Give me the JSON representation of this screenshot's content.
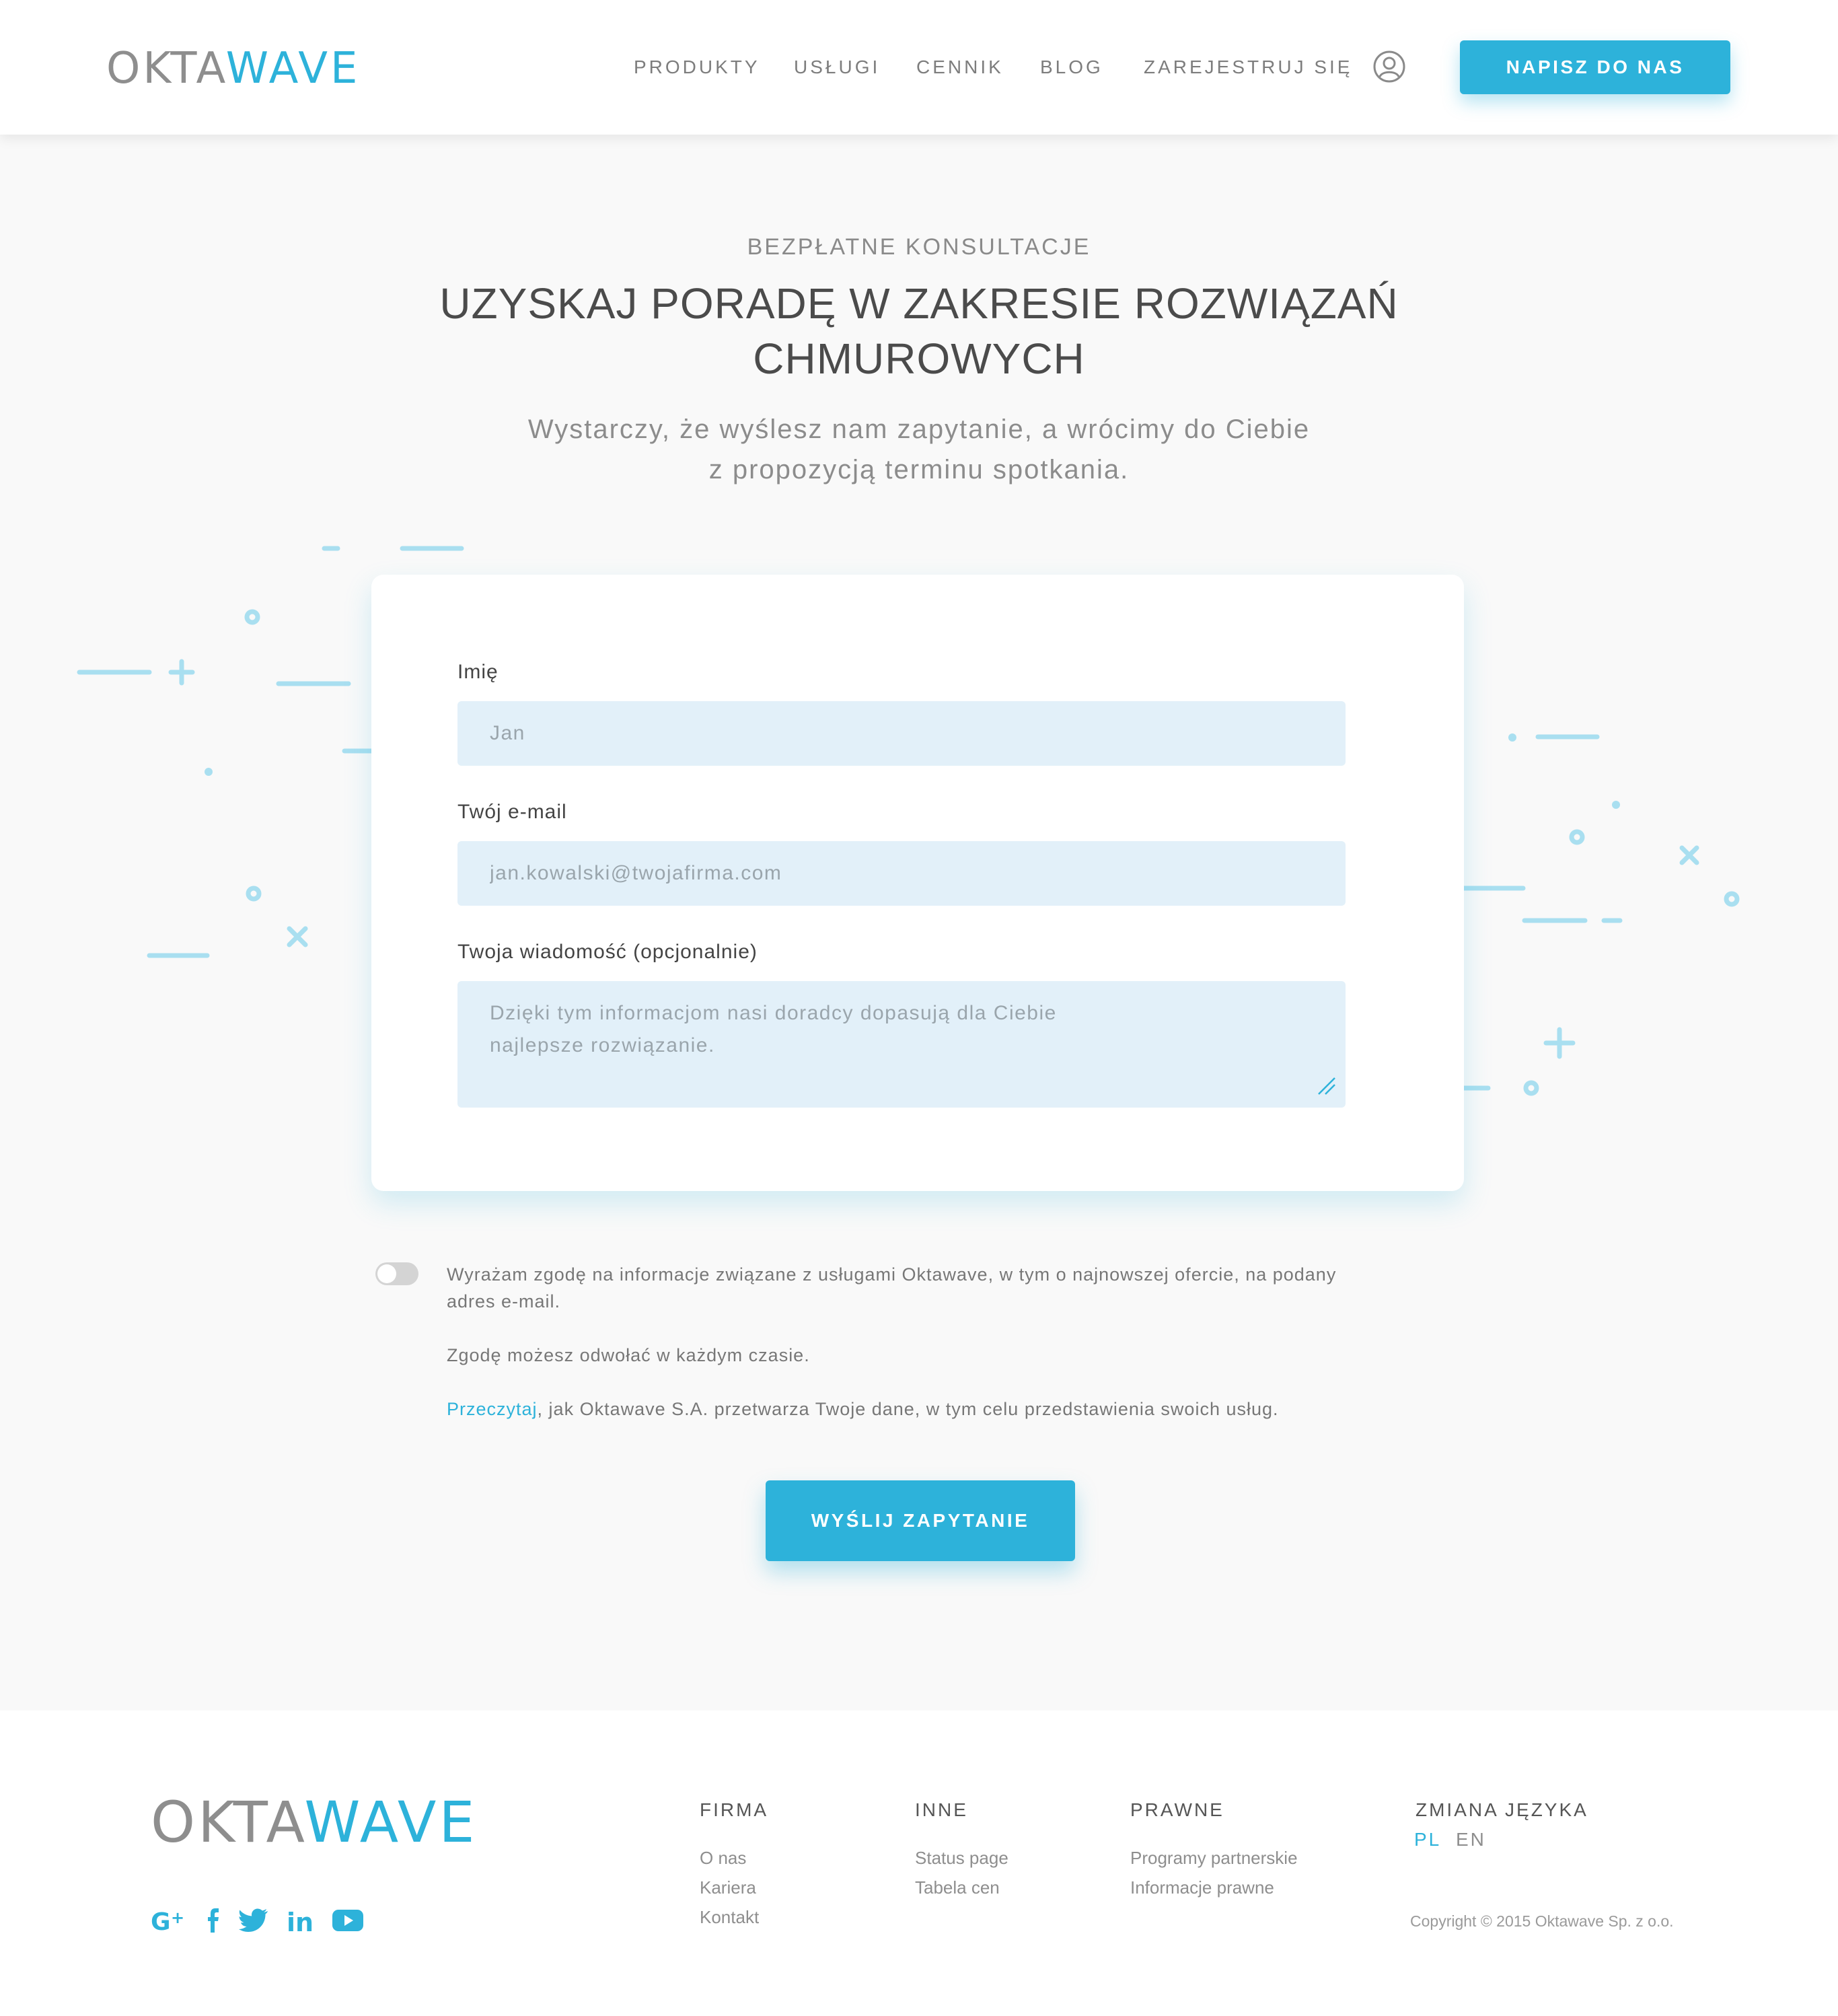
{
  "brand": {
    "logo_part1": "OKTA",
    "logo_part2": "WAVE",
    "accent_color": "#2db2da"
  },
  "nav": {
    "items": [
      "PRODUKTY",
      "USŁUGI",
      "CENNIK",
      "BLOG",
      "ZAREJESTRUJ SIĘ"
    ],
    "user_icon": "user-circle-icon",
    "cta": "NAPISZ DO NAS"
  },
  "hero": {
    "eyebrow": "BEZPŁATNE KONSULTACJE",
    "headline_line1": "UZYSKAJ PORADĘ W ZAKRESIE ROZWIĄZAŃ",
    "headline_line2": "CHMUROWYCH",
    "lead_line1": "Wystarczy, że wyślesz nam zapytanie, a wrócimy do Ciebie",
    "lead_line2": "z propozycją terminu spotkania."
  },
  "form": {
    "name_label": "Imię",
    "name_placeholder": "Jan",
    "email_label": "Twój e-mail",
    "email_placeholder": "jan.kowalski@twojafirma.com",
    "message_label": "Twoja wiadomość (opcjonalnie)",
    "message_placeholder": "Dzięki tym informacjom nasi doradcy dopasują dla Ciebie\nnajlepsze rozwiązanie."
  },
  "consent": {
    "toggle_on": false,
    "text_line1": "Wyrażam zgodę na informacje związane z usługami Oktawave, w tym o najnowszej ofercie, na podany",
    "text_line2": "adres e-mail.",
    "revoke_text": "Zgodę możesz odwołać w każdym czasie.",
    "read_link": "Przeczytaj",
    "read_rest": ", jak Oktawave S.A. przetwarza Twoje dane, w tym celu przedstawienia swoich usług."
  },
  "submit_label": "WYŚLIJ ZAPYTANIE",
  "footer": {
    "columns": [
      {
        "title": "FIRMA",
        "links": [
          "O nas",
          "Kariera",
          "Kontakt"
        ]
      },
      {
        "title": "INNE",
        "links": [
          "Status page",
          "Tabela cen"
        ]
      },
      {
        "title": "PRAWNE",
        "links": [
          "Programy partnerskie",
          "Informacje prawne"
        ]
      }
    ],
    "language_title": "ZMIANA JĘZYKA",
    "languages": [
      "PL",
      "EN"
    ],
    "active_language": "PL",
    "copyright": "Copyright © 2015 Oktawave Sp. z o.o.",
    "social": [
      "google-plus-icon",
      "facebook-icon",
      "twitter-icon",
      "linkedin-icon",
      "youtube-icon"
    ]
  }
}
